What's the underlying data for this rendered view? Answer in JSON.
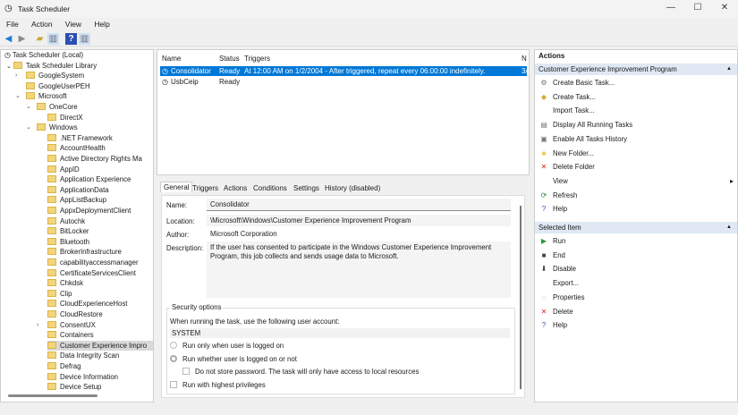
{
  "window": {
    "title": "Task Scheduler",
    "minimize": "—",
    "maximize": "☐",
    "close": "✕"
  },
  "menu": [
    "File",
    "Action",
    "View",
    "Help"
  ],
  "tree": {
    "root": "Task Scheduler (Local)",
    "library": "Task Scheduler Library",
    "items": [
      {
        "label": "GoogleSystem",
        "level": 2,
        "chev": "›"
      },
      {
        "label": "GoogleUserPEH",
        "level": 2,
        "chev": ""
      },
      {
        "label": "Microsoft",
        "level": 2,
        "chev": "⌄"
      },
      {
        "label": "OneCore",
        "level": 3,
        "chev": "⌄"
      },
      {
        "label": "DirectX",
        "level": 4,
        "chev": ""
      },
      {
        "label": "Windows",
        "level": 3,
        "chev": "⌄"
      },
      {
        "label": ".NET Framework",
        "level": 4,
        "chev": ""
      },
      {
        "label": "AccountHealth",
        "level": 4,
        "chev": ""
      },
      {
        "label": "Active Directory Rights Ma",
        "level": 4,
        "chev": ""
      },
      {
        "label": "AppID",
        "level": 4,
        "chev": ""
      },
      {
        "label": "Application Experience",
        "level": 4,
        "chev": ""
      },
      {
        "label": "ApplicationData",
        "level": 4,
        "chev": ""
      },
      {
        "label": "AppListBackup",
        "level": 4,
        "chev": ""
      },
      {
        "label": "AppxDeploymentClient",
        "level": 4,
        "chev": ""
      },
      {
        "label": "Autochk",
        "level": 4,
        "chev": ""
      },
      {
        "label": "BitLocker",
        "level": 4,
        "chev": ""
      },
      {
        "label": "Bluetooth",
        "level": 4,
        "chev": ""
      },
      {
        "label": "BrokerInfrastructure",
        "level": 4,
        "chev": ""
      },
      {
        "label": "capabilityaccessmanager",
        "level": 4,
        "chev": ""
      },
      {
        "label": "CertificateServicesClient",
        "level": 4,
        "chev": ""
      },
      {
        "label": "Chkdsk",
        "level": 4,
        "chev": ""
      },
      {
        "label": "Clip",
        "level": 4,
        "chev": ""
      },
      {
        "label": "CloudExperienceHost",
        "level": 4,
        "chev": ""
      },
      {
        "label": "CloudRestore",
        "level": 4,
        "chev": ""
      },
      {
        "label": "ConsentUX",
        "level": 4,
        "chev": "›"
      },
      {
        "label": "Containers",
        "level": 4,
        "chev": ""
      },
      {
        "label": "Customer Experience Impro",
        "level": 4,
        "chev": "",
        "selected": true
      },
      {
        "label": "Data Integrity Scan",
        "level": 4,
        "chev": ""
      },
      {
        "label": "Defrag",
        "level": 4,
        "chev": ""
      },
      {
        "label": "Device Information",
        "level": 4,
        "chev": ""
      },
      {
        "label": "Device Setup",
        "level": 4,
        "chev": ""
      }
    ]
  },
  "tasks": {
    "headers": [
      "Name",
      "Status",
      "Triggers",
      "N"
    ],
    "rows": [
      {
        "name": "Consolidator",
        "status": "Ready",
        "trigger": "At 12:00 AM on 1/2/2004 - After triggered, repeat every 06:00:00 indefinitely.",
        "next": "3/"
      },
      {
        "name": "UsbCeip",
        "status": "Ready",
        "trigger": "",
        "next": ""
      }
    ]
  },
  "tabs": [
    "General",
    "Triggers",
    "Actions",
    "Conditions",
    "Settings",
    "History (disabled)"
  ],
  "general": {
    "name_label": "Name:",
    "name": "Consolidator",
    "location_label": "Location:",
    "location": "\\Microsoft\\Windows\\Customer Experience Improvement Program",
    "author_label": "Author:",
    "author": "Microsoft Corporation",
    "description_label": "Description:",
    "description": "If the user has consented to participate in the Windows Customer Experience Improvement Program, this job collects and sends usage data to Microsoft.",
    "security_title": "Security options",
    "account_prompt": "When running the task, use the following user account:",
    "account": "SYSTEM",
    "opt_logged_on": "Run only when user is logged on",
    "opt_whether": "Run whether user is logged on or not",
    "opt_no_password": "Do not store password.  The task will only have access to local resources",
    "opt_highest": "Run with highest privileges"
  },
  "actions": {
    "title": "Actions",
    "section1": "Customer Experience Improvement Program",
    "items1": [
      {
        "label": "Create Basic Task...",
        "icon": "⚙",
        "color": "#777"
      },
      {
        "label": "Create Task...",
        "icon": "◆",
        "color": "#d8a93a"
      },
      {
        "label": "Import Task...",
        "icon": "",
        "color": "#777"
      },
      {
        "label": "Display All Running Tasks",
        "icon": "▤",
        "color": "#777"
      },
      {
        "label": "Enable All Tasks History",
        "icon": "▣",
        "color": "#777"
      },
      {
        "label": "New Folder...",
        "icon": "■",
        "color": "#f0c95a"
      },
      {
        "label": "Delete Folder",
        "icon": "✕",
        "color": "#d9261c"
      },
      {
        "label": "View",
        "icon": "",
        "color": "#777",
        "arrow": "▸"
      },
      {
        "label": "Refresh",
        "icon": "⟳",
        "color": "#2a8a3a"
      },
      {
        "label": "Help",
        "icon": "?",
        "color": "#2a4fb0"
      }
    ],
    "section2": "Selected Item",
    "items2": [
      {
        "label": "Run",
        "icon": "▶",
        "color": "#2a9a3a"
      },
      {
        "label": "End",
        "icon": "■",
        "color": "#444"
      },
      {
        "label": "Disable",
        "icon": "⬇",
        "color": "#444"
      },
      {
        "label": "Export...",
        "icon": "",
        "color": "#777"
      },
      {
        "label": "Properties",
        "icon": "◌",
        "color": "#777"
      },
      {
        "label": "Delete",
        "icon": "✕",
        "color": "#d9261c"
      },
      {
        "label": "Help",
        "icon": "?",
        "color": "#2a4fb0"
      }
    ]
  }
}
